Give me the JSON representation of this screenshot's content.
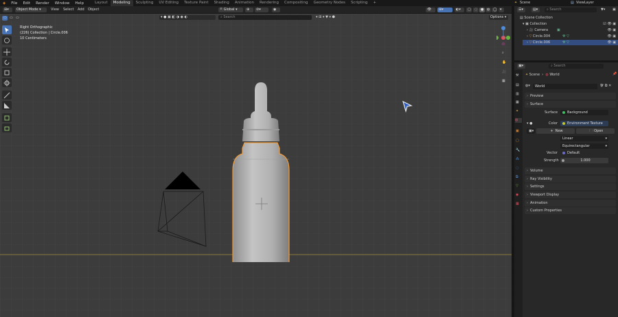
{
  "menubar": {
    "items": [
      "File",
      "Edit",
      "Render",
      "Window",
      "Help"
    ],
    "workspaces": [
      "Layout",
      "Modeling",
      "Sculpting",
      "UV Editing",
      "Texture Paint",
      "Shading",
      "Animation",
      "Rendering",
      "Compositing",
      "Geometry Nodes",
      "Scripting"
    ],
    "active_workspace": "Modeling",
    "add_tab": "+",
    "scene": "Scene",
    "view_layer": "ViewLayer"
  },
  "viewport_header": {
    "mode": "Object Mode",
    "menus": [
      "View",
      "Select",
      "Add",
      "Object"
    ],
    "orientation": "Global",
    "options": "Options",
    "search_placeholder": "Search"
  },
  "viewport_overlay": {
    "view": "Right Orthographic",
    "collection": "(226) Collection | Circle.006",
    "scale": "10 Centimeters"
  },
  "outliner": {
    "search_placeholder": "Search",
    "root": "Scene Collection",
    "collection": "Collection",
    "items": [
      {
        "name": "Camera",
        "selected": false
      },
      {
        "name": "Circle.004",
        "selected": false
      },
      {
        "name": "Circle.006",
        "selected": true
      }
    ]
  },
  "properties": {
    "search_placeholder": "Search",
    "breadcrumb_scene": "Scene",
    "breadcrumb_world": "World",
    "world_name": "World",
    "panels_top": [
      "Preview",
      "Surface"
    ],
    "surface_label": "Surface",
    "surface_value": "Background",
    "color_label": "Color",
    "color_value": "Environment Texture",
    "new_label": "New",
    "open_label": "Open",
    "interp": "Linear",
    "projection": "Equirectangular",
    "vector_label": "Vector",
    "vector_value": "Default",
    "strength_label": "Strength",
    "strength_value": "1.000",
    "panels_bottom": [
      "Volume",
      "Ray Visibility",
      "Settings",
      "Viewport Display",
      "Animation",
      "Custom Properties"
    ]
  },
  "colors": {
    "accent": "#4772b3",
    "selection_outline": "#f29c3a",
    "viewport_bg": "#3c3c3c",
    "horizon_line": "#a58a3a"
  }
}
